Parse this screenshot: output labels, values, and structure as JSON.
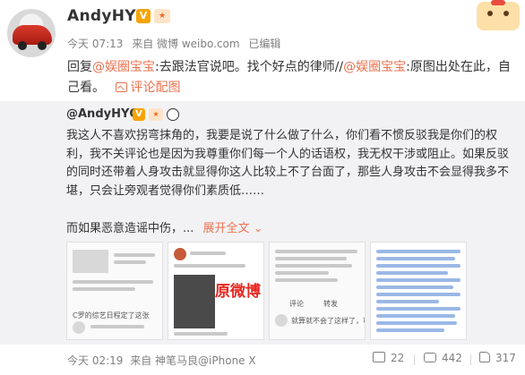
{
  "post": {
    "username": "AndyHYQ",
    "v_badge": "V",
    "level_badge": "★",
    "meta": {
      "time": "今天 07:13",
      "source": "来自 微博 weibo.com",
      "edited": "已编辑"
    },
    "text": {
      "reply": "回复",
      "mention1": "@娱圈宝宝",
      "part1": ":去跟法官说吧。找个好点的律师//",
      "mention2": "@娱圈宝宝",
      "part2": ":原图出处在此，自己看。",
      "pic_link": "评论配图"
    }
  },
  "repost": {
    "username": "@AndyHYQ",
    "v_badge": "V",
    "level_badge": "★",
    "text": "我这人不喜欢拐弯抹角的，我要是说了什么做了什么，你们看不惯反驳我是你们的权利，我不关评论也是因为我尊重你们每一个人的话语权，我无权干涉或阻止。如果反驳的同时还带着人身攻击就显得你这人比较上不了台面了，那些人身攻击不会显得我多不堪，只会让旁观者觉得你们素质低……",
    "more_text": "而如果恶意造谣中伤，...",
    "expand_label": "展开全文",
    "expand_icon": "chevron-down-icon",
    "thumb_label_1": "C罗的综艺日程定了这张",
    "thumb_label_2": "原微博",
    "thumb_label_3": "就算就不会了这样了，可靠我们别",
    "thumb_label_4": "评论",
    "thumb_label_5": "转发"
  },
  "footer": {
    "time": "今天 02:19",
    "source": "来自 神笔马良@iPhone X",
    "shares": "22",
    "comments": "442",
    "likes": "317"
  },
  "colors": {
    "link": "#eb7350",
    "muted": "#808080",
    "repost_bg": "#f2f2f5",
    "vip_badge": "#f7a400"
  }
}
